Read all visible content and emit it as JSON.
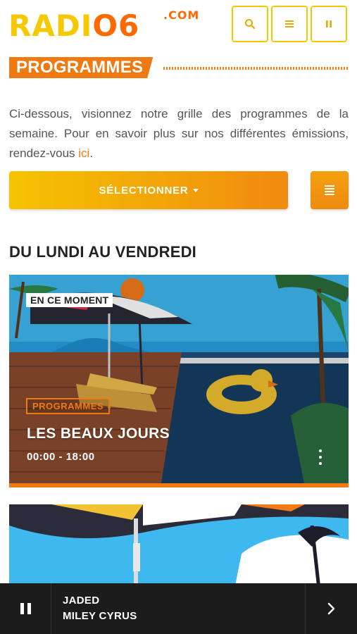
{
  "brand": {
    "logo_text": "RADI",
    "logo_accent": "O6",
    "logo_suffix": ".COM",
    "primary_color": "#f5c800",
    "accent_color": "#f07a12"
  },
  "header": {
    "buttons": [
      {
        "icon": "search-icon"
      },
      {
        "icon": "menu-icon"
      },
      {
        "icon": "pause-icon"
      }
    ]
  },
  "page": {
    "section_title": "PROGRAMMES",
    "intro_text": "Ci-dessous, visionnez notre grille des programmes de la semaine. Pour en savoir plus sur nos différentes émissions, rendez-vous ",
    "intro_link": "ici",
    "intro_end": ".",
    "select_label": "SÉLECTIONNER",
    "list_icon": "list-icon",
    "day_title": "DU LUNDI AU VENDREDI"
  },
  "programs": [
    {
      "now_tag": "EN CE MOMENT",
      "category": "PROGRAMMES",
      "title": "LES BEAUX JOURS",
      "time": "00:00 - 18:00"
    }
  ],
  "player": {
    "title": "JADED",
    "artist": "MILEY CYRUS",
    "play_icon": "pause-icon",
    "next_icon": "chevron-right-icon"
  }
}
